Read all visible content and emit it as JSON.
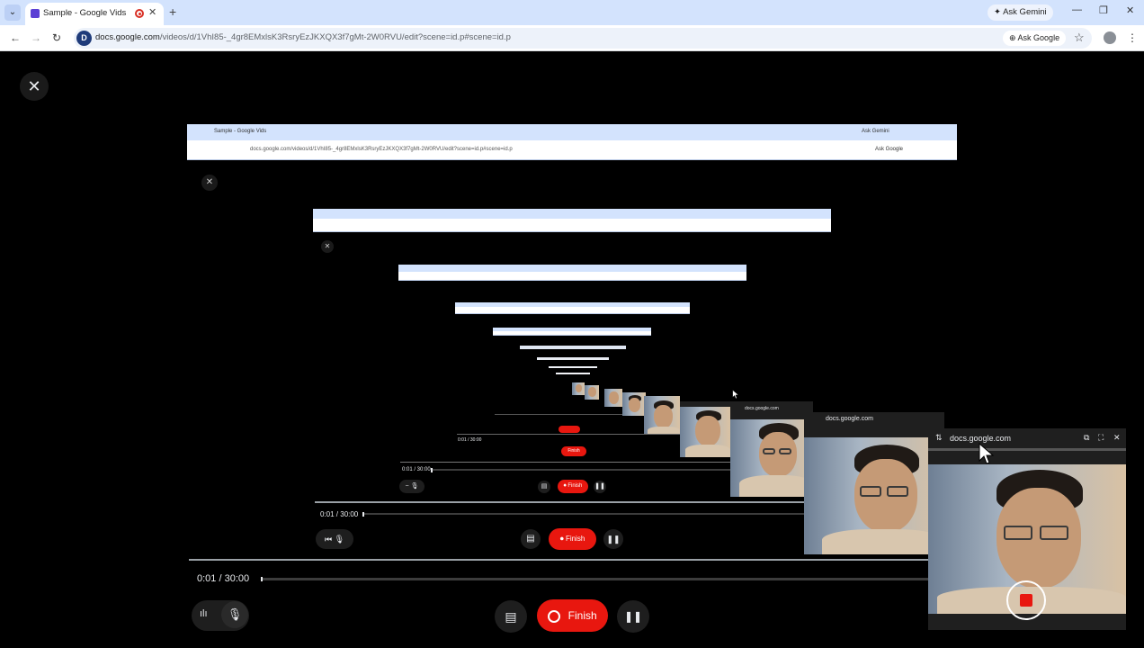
{
  "browser": {
    "tab_title": "Sample - Google Vids",
    "new_tab_icon": "plus-icon",
    "ask_gemini": "Ask Gemini",
    "url_domain": "docs.google.com",
    "url_path": "/videos/d/1VhI85-_4gr8EMxlsK3RsryEzJKXQX3f7gMt-2W0RVU/edit?scene=id.p#scene=id.p",
    "ask_google": "Ask Google"
  },
  "recording": {
    "elapsed": "0:01",
    "duration": "30:00",
    "time_display": "0:01 / 30:00",
    "finish_label": "Finish"
  },
  "nested": {
    "time_display": "0:01 / 30:00",
    "finish_label": "Finish",
    "tab_title_small": "Sample - Google Vids",
    "ask_gemini_small": "Ask Gemini",
    "ask_google_small": "Ask Google"
  },
  "pip": {
    "title": "docs.google.com"
  },
  "colors": {
    "tabstrip": "#d3e3fd",
    "finish": "#e8170f",
    "overlay_bg": "#000000"
  }
}
